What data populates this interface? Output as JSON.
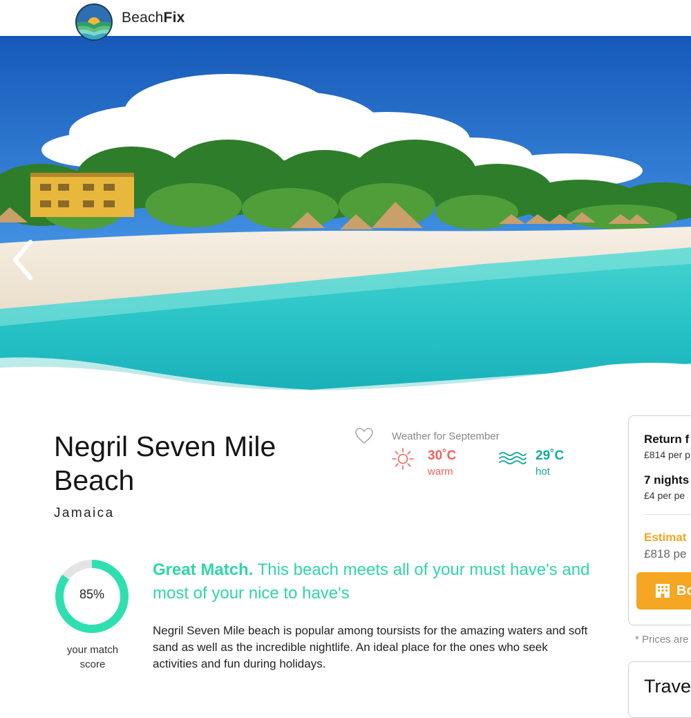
{
  "header": {
    "brand_regular": "Beach",
    "brand_bold": "Fix",
    "logo_icon": "beachfix-logo-icon"
  },
  "hero": {
    "prev_icon": "chevron-left-icon"
  },
  "beach": {
    "name": "Negril Seven Mile Beach",
    "country": "Jamaica",
    "favorite_icon": "heart-outline-icon"
  },
  "weather": {
    "label": "Weather for September",
    "air_temp": "30˚C",
    "air_desc": "warm",
    "air_icon": "sun-icon",
    "sea_temp": "29˚C",
    "sea_desc": "hot",
    "sea_icon": "waves-icon",
    "air_color": "#f0615d",
    "sea_color": "#14a89a"
  },
  "match": {
    "score_text": "85%",
    "score_value": 0.85,
    "score_caption": "your match score",
    "headline_bold": "Great Match.",
    "headline_rest": " This beach meets all of your must have's and most of your nice to have's",
    "description": "Negril Seven Mile beach is popular among toursists for the amazing waters and soft sand as well as the incredible nightlife. An ideal place for the ones who seek activities and fun during holidays.",
    "accent_color": "#2ed6a8"
  },
  "price_card": {
    "flight_title": "Return f",
    "flight_price": "£814 per p",
    "stay_title": "7 nights",
    "stay_price": "£4 per pe",
    "estimate_label": "Estimat",
    "estimate_value": "£818 pe",
    "book_label": "Bo",
    "book_icon": "hotel-building-icon",
    "accent_color": "#f5a623"
  },
  "prices_note": "* Prices are",
  "travel_card": {
    "title": "Trave"
  }
}
